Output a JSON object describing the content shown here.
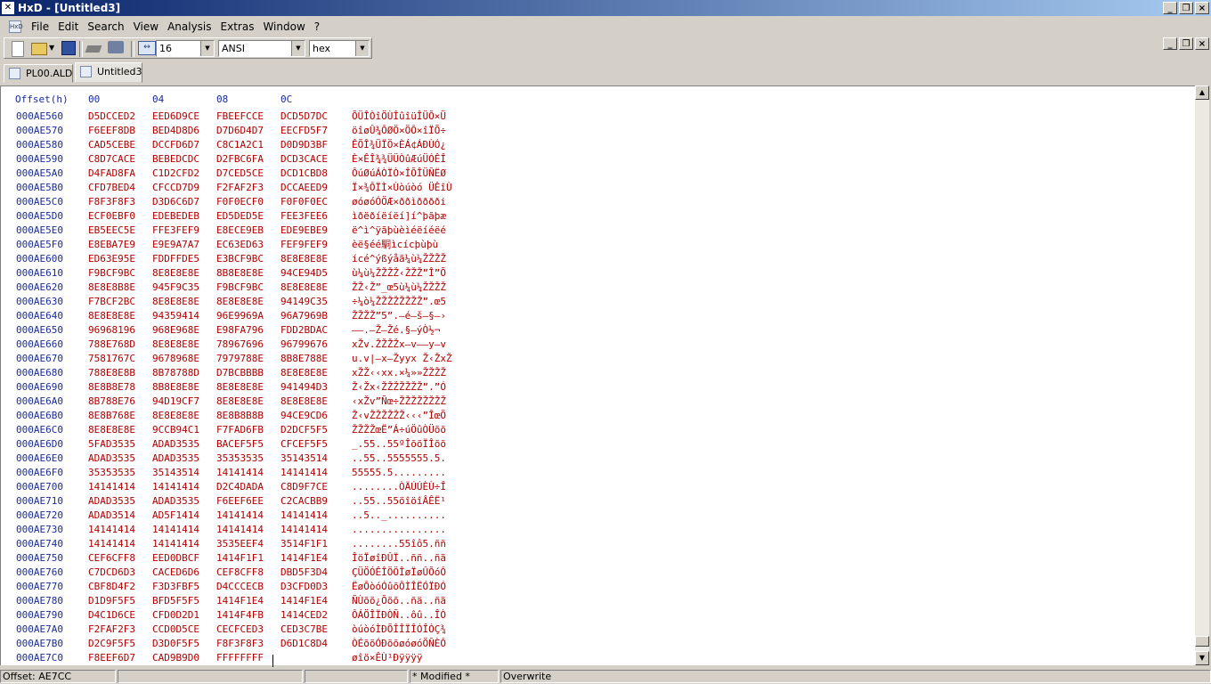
{
  "window": {
    "title": "HxD - [Untitled3]",
    "min": "_",
    "max": "❐",
    "close": "×"
  },
  "menu": [
    "File",
    "Edit",
    "Search",
    "View",
    "Analysis",
    "Extras",
    "Window",
    "?"
  ],
  "toolbar": {
    "bytes_per_row": "16",
    "charset": "ANSI",
    "offset_base": "hex"
  },
  "tabs": [
    {
      "label": "PL00.ALD",
      "active": false
    },
    {
      "label": "Untitled3",
      "active": true
    }
  ],
  "editor": {
    "header": {
      "offset": "Offset(h)",
      "cols": [
        "00",
        "04",
        "08",
        "0C"
      ]
    },
    "rows": [
      [
        "000AE560",
        "D5DCCED2",
        "EED6D9CE",
        "FBEEFCCE",
        "DCD5D7DC",
        "ÕÜÎÒîÖÙÎûîüÎÜÕ×Ü"
      ],
      [
        "000AE570",
        "F6EEF8DB",
        "BED4D8D6",
        "D7D6D4D7",
        "EECFD5F7",
        "öîøÛ¾ÔØÖ×ÖÔ×îÏÕ÷"
      ],
      [
        "000AE580",
        "CAD5CEBE",
        "DCCFD6D7",
        "C8C1A2C1",
        "D0D9D3BF",
        "ÊÕÎ¾ÜÏÖ×ÈÁ¢ÁÐÙÓ¿"
      ],
      [
        "000AE590",
        "C8D7CACE",
        "BEBEDCDC",
        "D2FBC6FA",
        "DCD3CACE",
        "È×ÊÎ¾¾ÜÜÒûÆúÜÓÊÎ"
      ],
      [
        "000AE5A0",
        "D4FAD8FA",
        "C1D2CFD2",
        "D7CED5CE",
        "DCD1CBD8",
        "ÔúØúÁÒÏÒ×ÎÕÎÜÑËØ"
      ],
      [
        "000AE5B0",
        "CFD7BED4",
        "CFCCD7D9",
        "F2FAF2F3",
        "DCCAEED9",
        "Ï×¾ÔÏÌ×Ùòúòó ÜÊîÙ"
      ],
      [
        "000AE5C0",
        "F8F3F8F3",
        "D3D6C6D7",
        "F0F0ECF0",
        "F0F0F0EC",
        "øóøóÓÖÆ×ððìðððði"
      ],
      [
        "000AE5D0",
        "ECF0EBF0",
        "EDEBEDEB",
        "ED5DED5E",
        "FEE3FEE6",
        "ìðëðíëíëí]í^þãþæ"
      ],
      [
        "000AE5E0",
        "EB5EEC5E",
        "FFE3FEF9",
        "E8ECE9EB",
        "EDE9EBE9",
        "ë^ì^ÿãþùèìéëíéëé"
      ],
      [
        "000AE5F0",
        "E8EBA7E9",
        "E9E9A7A7",
        "EC63ED63",
        "FEF9FEF9",
        "èë§éé駧ìcícþùþù"
      ],
      [
        "000AE600",
        "ED63E95E",
        "FDDFFDE5",
        "E3BCF9BC",
        "8E8E8E8E",
        "ícé^ýßýåã¼ù¼ŽŽŽŽ"
      ],
      [
        "000AE610",
        "F9BCF9BC",
        "8E8E8E8E",
        "8B8E8E8E",
        "94CE94D5",
        "ù¼ù¼ŽŽŽŽ‹ŽŽŽ”Î”Õ"
      ],
      [
        "000AE620",
        "8E8E8B8E",
        "945F9C35",
        "F9BCF9BC",
        "8E8E8E8E",
        "ŽŽ‹Ž”_œ5ù¼ù¼ŽŽŽŽ"
      ],
      [
        "000AE630",
        "F7BCF2BC",
        "8E8E8E8E",
        "8E8E8E8E",
        "94149C35",
        "÷¼ò¼ŽŽŽŽŽŽŽŽ”.œ5"
      ],
      [
        "000AE640",
        "8E8E8E8E",
        "94359414",
        "96E9969A",
        "96A7969B",
        "ŽŽŽŽ”5”.–é–š–§–›"
      ],
      [
        "000AE650",
        "96968196",
        "968E968E",
        "E98FA796",
        "FDD2BDAC",
        "––.–Ž–Žé.§–ýÒ½¬"
      ],
      [
        "000AE660",
        "788E768D",
        "8E8E8E8E",
        "78967696",
        "96799676",
        "xŽv.ŽŽŽŽx–v––y–v"
      ],
      [
        "000AE670",
        "7581767C",
        "9678968E",
        "7979788E",
        "8B8E788E",
        "u.v|–x–Žyyx Ž‹ŽxŽ"
      ],
      [
        "000AE680",
        "788E8E8B",
        "8B78788D",
        "D7BCBBBB",
        "8E8E8E8E",
        "xŽŽ‹‹xx.×¼»»ŽŽŽŽ"
      ],
      [
        "000AE690",
        "8E8B8E78",
        "8B8E8E8E",
        "8E8E8E8E",
        "941494D3",
        "Ž‹Žx‹ŽŽŽŽŽŽŽ”.”Ó"
      ],
      [
        "000AE6A0",
        "8B788E76",
        "94D19CF7",
        "8E8E8E8E",
        "8E8E8E8E",
        "‹xŽv”Ñœ÷ŽŽŽŽŽŽŽŽ"
      ],
      [
        "000AE6B0",
        "8E8B768E",
        "8E8E8E8E",
        "8E8B8B8B",
        "94CE9CD6",
        "Ž‹vŽŽŽŽŽŽ‹‹‹”ÎœÖ"
      ],
      [
        "000AE6C0",
        "8E8E8E8E",
        "9CCB94C1",
        "F7FAD6FB",
        "D2DCF5F5",
        "ŽŽŽŽœË”Á÷úÖûÒÜõõ"
      ],
      [
        "000AE6D0",
        "5FAD3535",
        "ADAD3535",
        "BACEF5F5",
        "CFCEF5F5",
        "_.55..55ºÎõõÏÎõõ"
      ],
      [
        "000AE6E0",
        "ADAD3535",
        "ADAD3535",
        "35353535",
        "35143514",
        "..55..5555555.5."
      ],
      [
        "000AE6F0",
        "35353535",
        "35143514",
        "14141414",
        "14141414",
        "55555.5........."
      ],
      [
        "000AE700",
        "14141414",
        "14141414",
        "D2C4DADA",
        "C8D9F7CE",
        "........ÒÄÚÚÈÙ÷Î"
      ],
      [
        "000AE710",
        "ADAD3535",
        "ADAD3535",
        "F6EEF6EE",
        "C2CACBB9",
        "..55..55öîöîÂÊË¹"
      ],
      [
        "000AE720",
        "ADAD3514",
        "AD5F1414",
        "14141414",
        "14141414",
        "..5.._.........."
      ],
      [
        "000AE730",
        "14141414",
        "14141414",
        "14141414",
        "14141414",
        "................"
      ],
      [
        "000AE740",
        "14141414",
        "14141414",
        "3535EEF4",
        "3514F1F1",
        "........55îô5.ññ"
      ],
      [
        "000AE750",
        "CEF6CFF8",
        "EED0DBCF",
        "1414F1F1",
        "1414F1E4",
        "ÎöÏøîÐÛÏ..ññ..ñä"
      ],
      [
        "000AE760",
        "C7DCD6D3",
        "CACED6D6",
        "CEF8CFF8",
        "DBD5F3D4",
        "ÇÜÖÓÊÎÖÖÎøÏøÛÕóÔ"
      ],
      [
        "000AE770",
        "CBF8D4F2",
        "F3D3FBF5",
        "D4CCCECB",
        "D3CFD0D3",
        "ËøÔòóÓûõÔÌÎËÓÏÐÓ"
      ],
      [
        "000AE780",
        "D1D9F5F5",
        "BFD5F5F5",
        "1414F1E4",
        "1414F1E4",
        "ÑÙõõ¿Õõõ..ñä..ñä"
      ],
      [
        "000AE790",
        "D4C1D6CE",
        "CFD0D2D1",
        "1414F4FB",
        "1414CED2",
        "ÔÁÖÎÏÐÒÑ..ôû..ÎÒ"
      ],
      [
        "000AE7A0",
        "F2FAF2F3",
        "CCD0D5CE",
        "CECFCED3",
        "CED3C7BE",
        "òúòóÌÐÕÎÎÏÎÓÎÓÇ¾"
      ],
      [
        "000AE7B0",
        "D2C9F5F5",
        "D3D0F5F5",
        "F8F3F8F3",
        "D6D1C8D4",
        "ÒÉõõÓÐõõøóøóÖÑÈÔ"
      ],
      [
        "000AE7C0",
        "F8EEF6D7",
        "CAD9B9D0",
        "FFFFFFFF",
        "",
        "øîö×ÊÙ¹Ðÿÿÿÿ"
      ]
    ]
  },
  "status": {
    "offset": "Offset: AE7CC",
    "p2": "",
    "p3": "",
    "modified": "* Modified *",
    "mode": "Overwrite"
  }
}
